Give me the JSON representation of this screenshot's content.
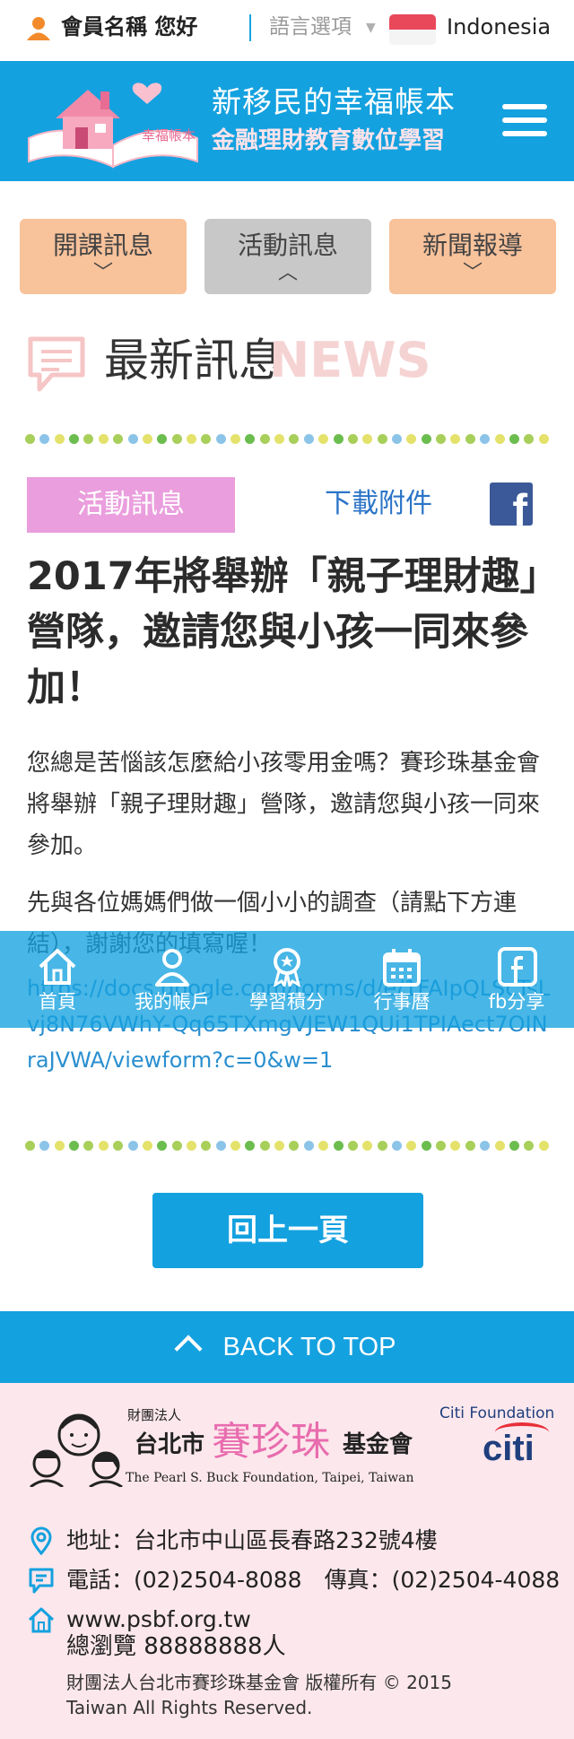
{
  "topbar": {
    "member_greeting": "會員名稱 您好",
    "language_label": "語言選項",
    "country": "Indonesia"
  },
  "header": {
    "logo_line1": "新移民的幸福帳本",
    "logo_line2": "金融理財教育數位學習",
    "logo_book_text": "幸福帳本"
  },
  "tabs": [
    {
      "label": "開課訊息",
      "chevron": "down"
    },
    {
      "label": "活動訊息",
      "chevron": "up"
    },
    {
      "label": "新聞報導",
      "chevron": "down"
    }
  ],
  "section": {
    "title": "最新訊息",
    "title_en": "NEWS"
  },
  "article": {
    "category": "活動訊息",
    "download": "下載附件",
    "title": "2017年將舉辦「親子理財趣」營隊，邀請您與小孩一同來參加！",
    "para1": "您總是苦惱該怎麼給小孩零用金嗎？賽珍珠基金會將舉辦「親子理財趣」營隊，邀請您與小孩一同來參加。",
    "para2": "先與各位媽媽們做一個小小的調查（請點下方連結），謝謝您的填寫喔！",
    "link": "https://docs.google.com/forms/d/e/1FAIpQLScTsLvj8N76VWhY-Qq65TXmgVJEW1QUi1TPIAect7OINraJVWA/viewform?c=0&w=1"
  },
  "floatnav": [
    {
      "label": "首頁",
      "icon": "home-icon"
    },
    {
      "label": "我的帳戶",
      "icon": "user-icon"
    },
    {
      "label": "學習積分",
      "icon": "badge-icon"
    },
    {
      "label": "行事曆",
      "icon": "calendar-icon"
    },
    {
      "label": "fb分享",
      "icon": "facebook-icon"
    }
  ],
  "back_button": "回上一頁",
  "back_to_top": "BACK TO TOP",
  "footer": {
    "org_prefix": "財團法人",
    "org_city": "台北市",
    "org_name": "賽珍珠",
    "org_suffix": "基金會",
    "org_en": "The Pearl S. Buck Foundation, Taipei, Taiwan",
    "citi_foundation": "Citi Foundation",
    "citi": "citi",
    "address": "地址：台北市中山區長春路232號4樓",
    "phone": "電話：(02)2504-8088　傳真：(02)2504-4088",
    "website": "www.psbf.org.tw",
    "views": "總瀏覽 88888888人",
    "copyright1": "財團法人台北市賽珍珠基金會 版權所有 © 2015",
    "copyright2": "Taiwan All Rights Reserved."
  },
  "colors": {
    "primary": "#14a1df",
    "tab_orange": "#f8c29b",
    "tab_gray": "#c8c8c8",
    "badge_pink": "#ea9edd",
    "footer_bg": "#fce7ec",
    "news_pink": "#f6d3d3"
  }
}
